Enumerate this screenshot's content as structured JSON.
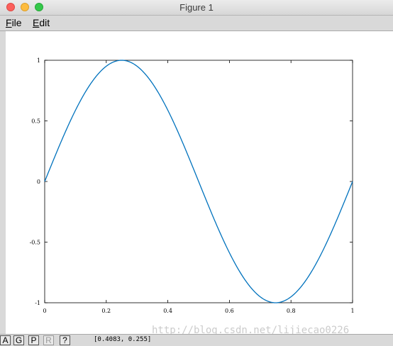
{
  "window": {
    "title": "Figure 1"
  },
  "menubar": {
    "items": [
      {
        "label_underlined": "F",
        "label_rest": "ile"
      },
      {
        "label_underlined": "E",
        "label_rest": "dit"
      }
    ]
  },
  "toolbar": {
    "buttons": [
      {
        "label": "A",
        "enabled": true
      },
      {
        "label": "G",
        "enabled": true
      },
      {
        "label": "P",
        "enabled": true
      },
      {
        "label": "R",
        "enabled": false
      },
      {
        "label": "?",
        "enabled": true
      }
    ]
  },
  "status": {
    "coordinates": "[0.4083, 0.255]"
  },
  "watermark": "http://blog.csdn.net/lijiecao0226",
  "chart_data": {
    "type": "line",
    "function": "sin(2*pi*x)",
    "xlim": [
      0,
      1
    ],
    "ylim": [
      -1,
      1
    ],
    "x_ticks": [
      0,
      0.2,
      0.4,
      0.6,
      0.8,
      1
    ],
    "x_tick_labels": [
      "0",
      "0.2",
      "0.4",
      "0.6",
      "0.8",
      "1"
    ],
    "y_ticks": [
      -1,
      -0.5,
      0,
      0.5,
      1
    ],
    "y_tick_labels": [
      "-1",
      "-0.5",
      "0",
      "0.5",
      "1"
    ],
    "grid": false,
    "series": [
      {
        "color": "#0072bd",
        "x": [
          0,
          0.05,
          0.1,
          0.15,
          0.2,
          0.25,
          0.3,
          0.35,
          0.4,
          0.45,
          0.5,
          0.55,
          0.6,
          0.65,
          0.7,
          0.75,
          0.8,
          0.85,
          0.9,
          0.95,
          1
        ],
        "y": [
          0,
          0.309,
          0.588,
          0.809,
          0.951,
          1,
          0.951,
          0.809,
          0.588,
          0.309,
          0,
          -0.309,
          -0.588,
          -0.809,
          -0.951,
          -1,
          -0.951,
          -0.809,
          -0.588,
          -0.309,
          0
        ]
      }
    ]
  }
}
